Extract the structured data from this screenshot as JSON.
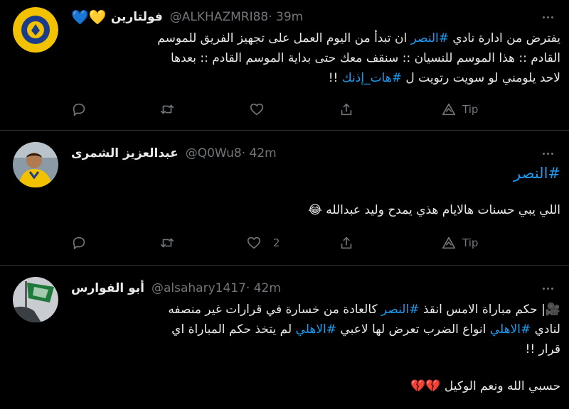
{
  "tweets": [
    {
      "hearts": "💙💛",
      "name": "فولتارين",
      "handle": "@ALKHAZMRI88",
      "time": " · 39m",
      "lines": [
        [
          "يفترض من ادارة نادي ",
          "#النصر",
          " ان تبدأ من اليوم العمل على تجهيز الفريق للموسم"
        ],
        [
          "القادم :: هذا الموسم للنسيان :: سنقف معك حتى بداية الموسم القادم :: بعدها"
        ],
        [
          "لاحد يلومني لو سويت رتويت ل ",
          "#هات_إذنك",
          " !!"
        ]
      ],
      "actions": {
        "reply": "",
        "retweet": "",
        "like": "",
        "tip": "Tip"
      }
    },
    {
      "hearts": "",
      "name": "عبدالعزيز الشمرى",
      "handle": "@Q0Wu8",
      "time": " · 42m",
      "hashtag_line": "#النصر",
      "body": "اللي يبي حسنات هالايام هذي يمدح وليد عبدالله 😂",
      "actions": {
        "reply": "",
        "retweet": "",
        "like": "2",
        "tip": "Tip"
      }
    },
    {
      "hearts": "",
      "name": "أبو الفوارس",
      "handle": "@alsahary1417",
      "time": " · 42m",
      "lines": [
        [
          "🎥| حكم مباراة الامس انقذ ",
          "#النصر",
          " كالعادة من خسارة في قرارات غير منصفه"
        ],
        [
          "لنادي ",
          "#الاهلي",
          " انواع الضرب تعرض لها لاعبي ",
          "#الاهلي",
          " لم يتخذ حكم المباراة اي"
        ],
        [
          "قرار !!"
        ],
        [
          "حسبي الله ونعم الوكيل 💔💔"
        ]
      ]
    }
  ],
  "colors": {
    "background": "#000000",
    "text": "#e7e9ea",
    "muted": "#71767b",
    "link": "#1d9bf0",
    "divider": "#2f3336"
  },
  "icons": [
    "avatar",
    "more-icon",
    "reply-icon",
    "retweet-icon",
    "like-icon",
    "share-icon",
    "tip-icon"
  ]
}
